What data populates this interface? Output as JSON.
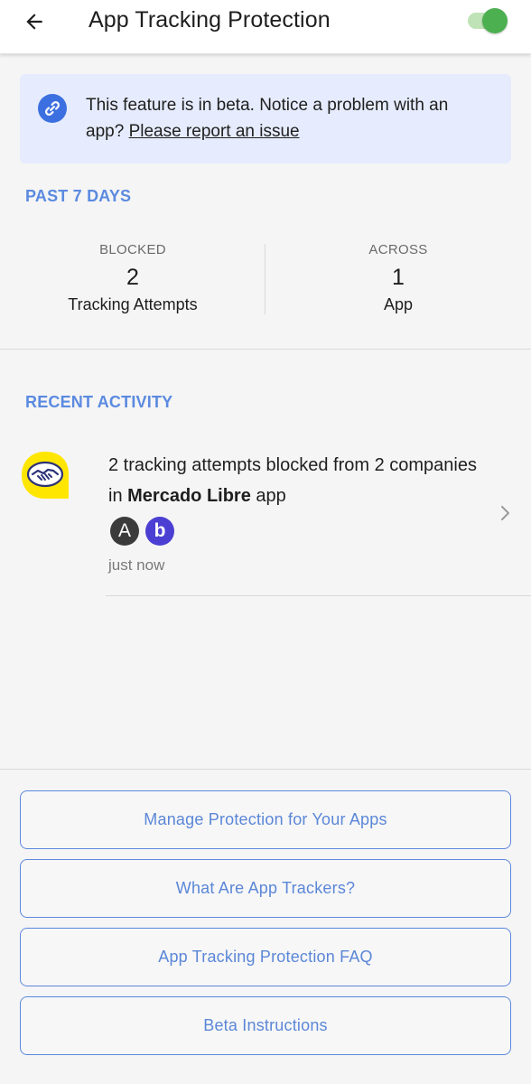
{
  "appbar": {
    "title": "App Tracking Protection",
    "toggle_on": true
  },
  "banner": {
    "text": "This feature is in beta. Notice a problem with an app?",
    "link": "Please report an issue"
  },
  "summary": {
    "heading": "PAST 7 DAYS",
    "blocked": {
      "caption": "BLOCKED",
      "value": "2",
      "label": "Tracking Attempts"
    },
    "across": {
      "caption": "ACROSS",
      "value": "1",
      "label": "App"
    }
  },
  "recent": {
    "heading": "RECENT ACTIVITY",
    "items": [
      {
        "text_prefix": "2 tracking attempts blocked from 2 companies in",
        "app_name": "Mercado Libre",
        "text_suffix": "app",
        "trackers": [
          "A",
          "b"
        ],
        "time": "just now"
      }
    ]
  },
  "buttons": {
    "manage": "Manage Protection for Your Apps",
    "what_are": "What Are App Trackers?",
    "faq": "App Tracking Protection FAQ",
    "beta": "Beta Instructions"
  },
  "colors": {
    "accent": "#5b87d8",
    "toggle": "#4caf50",
    "banner_bg": "#e6ecfd",
    "tracker_a": "#3b3b3b",
    "tracker_b": "#4b3fd3",
    "mercado_yellow": "#ffe600"
  },
  "icons": {
    "back": "arrow-left-icon",
    "banner": "link-icon",
    "chevron": "chevron-right-icon"
  }
}
